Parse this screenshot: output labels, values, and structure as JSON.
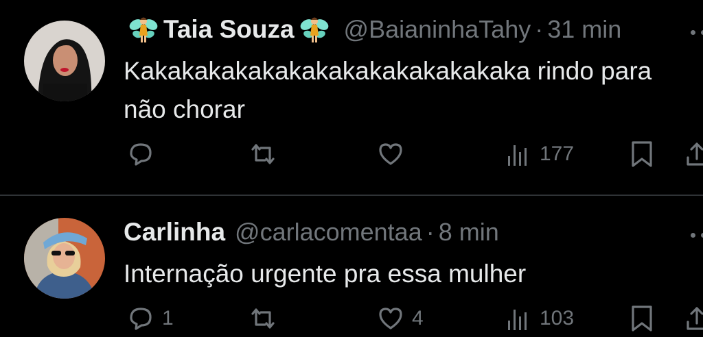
{
  "tweets": [
    {
      "display_name": "Taia Souza",
      "handle": "@BaianinhaTahy",
      "separator": "·",
      "time": "31 min",
      "text": "Kakakakakakakakakakakakakakaka rindo para não chorar",
      "reply_count": "",
      "retweet_count": "",
      "like_count": "",
      "view_count": "177",
      "name_decoration": "fairy-emoji"
    },
    {
      "display_name": "Carlinha",
      "handle": "@carlacomentaa",
      "separator": "·",
      "time": "8 min",
      "text": "Internação urgente pra essa mulher",
      "reply_count": "1",
      "retweet_count": "",
      "like_count": "4",
      "view_count": "103"
    }
  ],
  "icons": {
    "reply": "speech-bubble-icon",
    "retweet": "retweet-arrows-icon",
    "like": "heart-icon",
    "views": "bar-chart-icon",
    "bookmark": "bookmark-icon",
    "share": "share-icon",
    "more": "more-dots-icon"
  },
  "colors": {
    "background": "#000000",
    "text": "#e7e9ea",
    "secondary": "#71767b",
    "divider": "#2f3336"
  }
}
